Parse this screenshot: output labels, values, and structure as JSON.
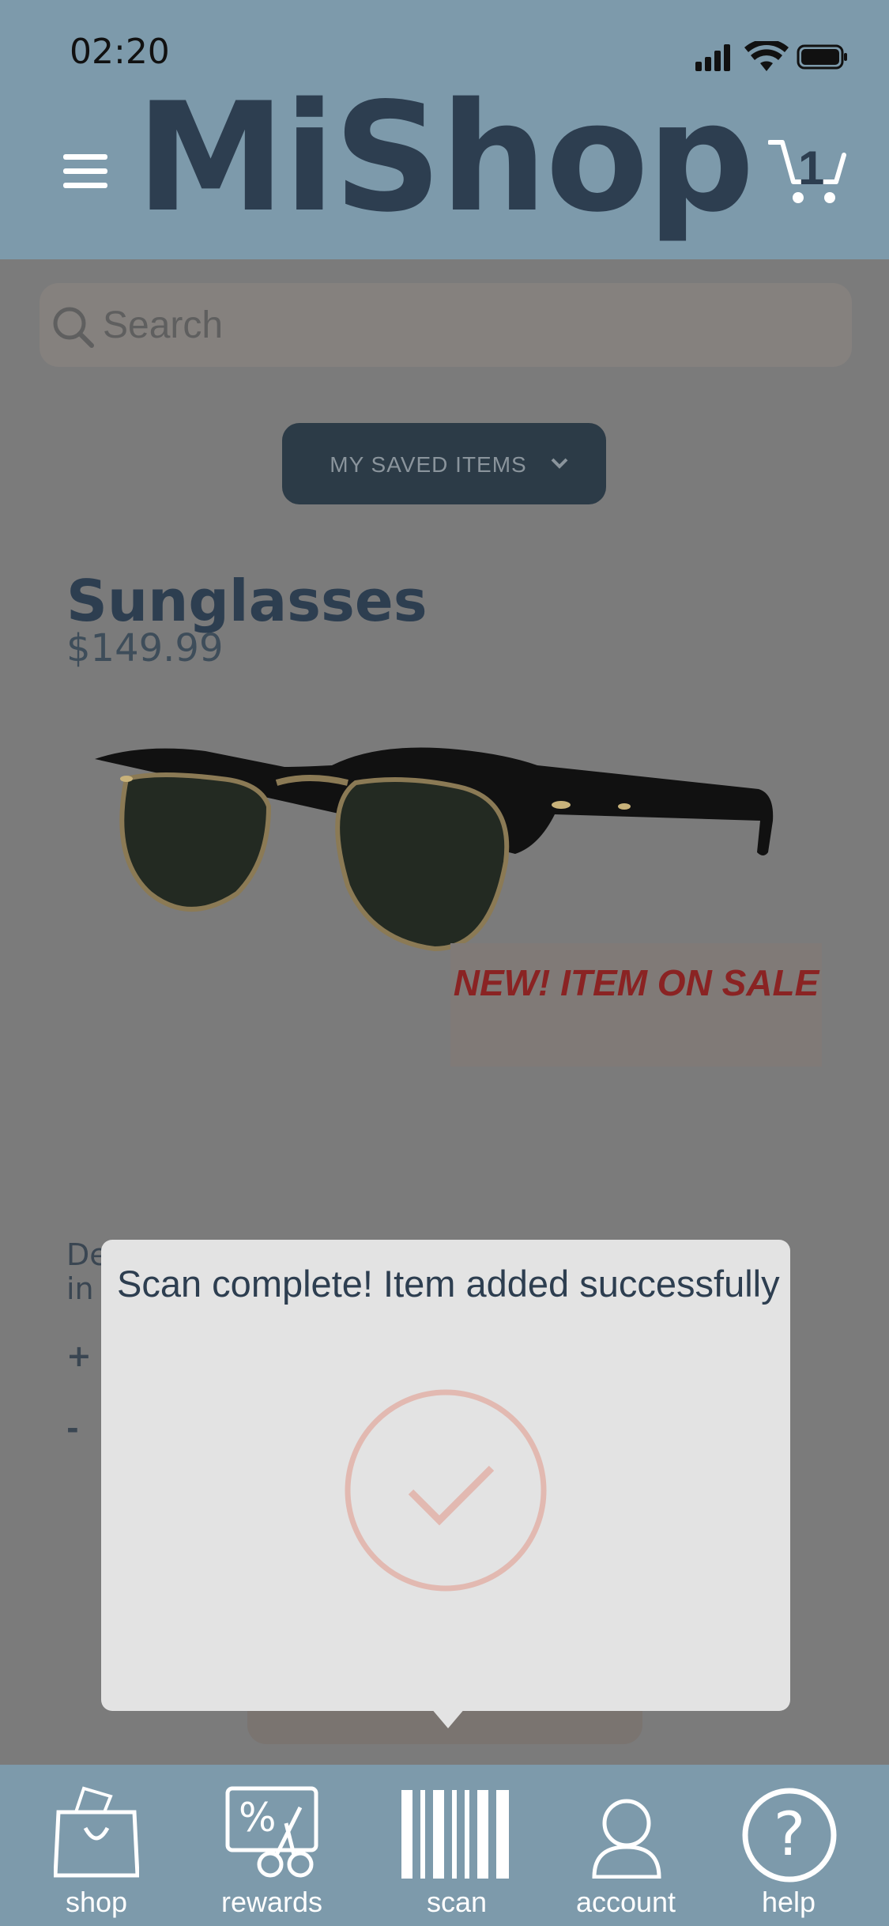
{
  "status_bar": {
    "time": "02:20"
  },
  "header": {
    "brand": "MiShop",
    "cart_count": "1"
  },
  "search": {
    "placeholder": "Search"
  },
  "saved_items": {
    "label": "MY SAVED ITEMS"
  },
  "product": {
    "title": "Sunglasses",
    "price": "$149.99",
    "badge": "NEW! ITEM ON SALE"
  },
  "dialog": {
    "message": "Scan complete! Item added successfully"
  },
  "tabs": [
    {
      "label": "shop",
      "icon": "shopping-bag-icon"
    },
    {
      "label": "rewards",
      "icon": "coupon-icon"
    },
    {
      "label": "scan",
      "icon": "barcode-icon"
    },
    {
      "label": "account",
      "icon": "user-icon"
    },
    {
      "label": "help",
      "icon": "help-icon"
    }
  ],
  "colors": {
    "header": "#7d9aab",
    "brand": "#2d3e50",
    "sale": "#8a2323",
    "check": "#e2b9b1"
  }
}
